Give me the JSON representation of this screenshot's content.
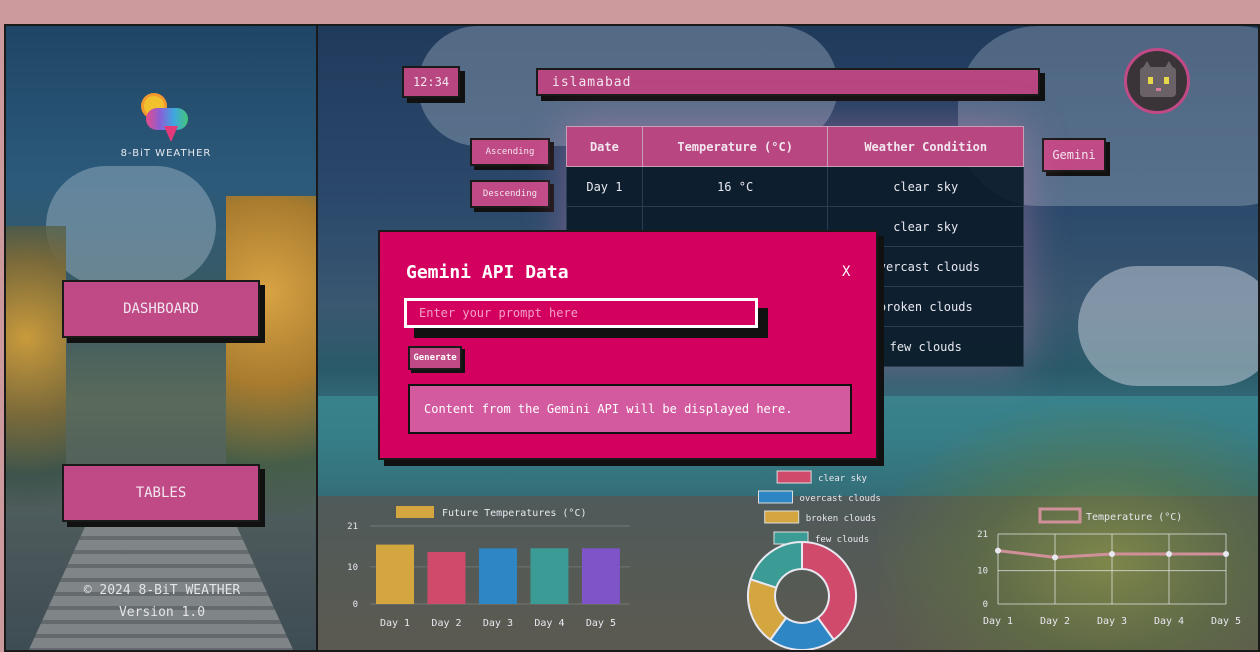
{
  "app": {
    "name": "8-BiT WEATHER"
  },
  "sidebar": {
    "nav": [
      {
        "label": "DASHBOARD"
      },
      {
        "label": "TABLES"
      }
    ],
    "footer": {
      "copyright": "© 2024 8-BiT WEATHER",
      "version": "Version 1.0"
    }
  },
  "header": {
    "clock": "12:34",
    "city": "islamabad"
  },
  "sort": {
    "asc_label": "Ascending",
    "desc_label": "Descending"
  },
  "gemini_button": "Gemini",
  "table": {
    "headers": [
      "Date",
      "Temperature (°C)",
      "Weather Condition"
    ],
    "rows": [
      [
        "Day 1",
        "16 °C",
        "clear sky"
      ],
      [
        "",
        "",
        "clear sky"
      ],
      [
        "",
        "",
        "overcast clouds"
      ],
      [
        "",
        "",
        "broken clouds"
      ],
      [
        "",
        "",
        "few clouds"
      ]
    ]
  },
  "modal": {
    "title": "Gemini API Data",
    "close_label": "X",
    "prompt_placeholder": "Enter your prompt here",
    "generate_label": "Generate",
    "output_text": "Content from the Gemini API will be displayed here."
  },
  "chart_data": [
    {
      "type": "bar",
      "legend": [
        {
          "name": "Future Temperatures (°C)",
          "color": "#d4a640"
        }
      ],
      "categories": [
        "Day 1",
        "Day 2",
        "Day 3",
        "Day 4",
        "Day 5"
      ],
      "values": [
        16,
        14,
        15,
        15,
        15
      ],
      "colors": [
        "#d4a640",
        "#d04a6c",
        "#2e86c4",
        "#3a9c94",
        "#7e54c8"
      ],
      "yticks": [
        "21",
        "10",
        "0"
      ],
      "ylim": [
        0,
        21
      ]
    },
    {
      "type": "pie",
      "donut": true,
      "labels": [
        "clear sky",
        "overcast clouds",
        "broken clouds",
        "few clouds"
      ],
      "values": [
        2,
        1,
        1,
        1
      ],
      "colors": [
        "#d04a6c",
        "#2e86c4",
        "#d4a640",
        "#3a9c94"
      ]
    },
    {
      "type": "line",
      "legend": [
        {
          "name": "Temperature (°C)",
          "color": "#d0909a"
        }
      ],
      "categories": [
        "Day 1",
        "Day 2",
        "Day 3",
        "Day 4",
        "Day 5"
      ],
      "values": [
        16,
        14,
        15,
        15,
        15
      ],
      "yticks": [
        "21",
        "10",
        "0"
      ],
      "ylim": [
        0,
        21
      ],
      "color": "#d0909a"
    }
  ]
}
